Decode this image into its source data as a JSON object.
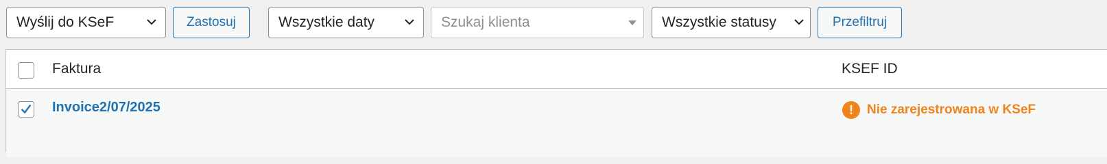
{
  "toolbar": {
    "bulk_action": {
      "selected": "Wyślij do KSeF"
    },
    "apply_label": "Zastosuj",
    "date_filter": {
      "selected": "Wszystkie daty"
    },
    "client_search": {
      "placeholder": "Szukaj klienta"
    },
    "status_filter": {
      "selected": "Wszystkie statusy"
    },
    "filter_label": "Przefiltruj"
  },
  "table": {
    "columns": {
      "invoice": "Faktura",
      "ksef_id": "KSEF ID"
    },
    "rows": [
      {
        "checked": true,
        "invoice": "Invoice2/07/2025",
        "ksef_status": "Nie zarejestrowana w KSeF"
      }
    ]
  },
  "colors": {
    "accent": "#2271b1",
    "warning": "#f0841c"
  },
  "icons": {
    "dropdown": "chevron-down-icon",
    "status": "exclamation-circle-icon",
    "check": "checkmark-icon"
  }
}
